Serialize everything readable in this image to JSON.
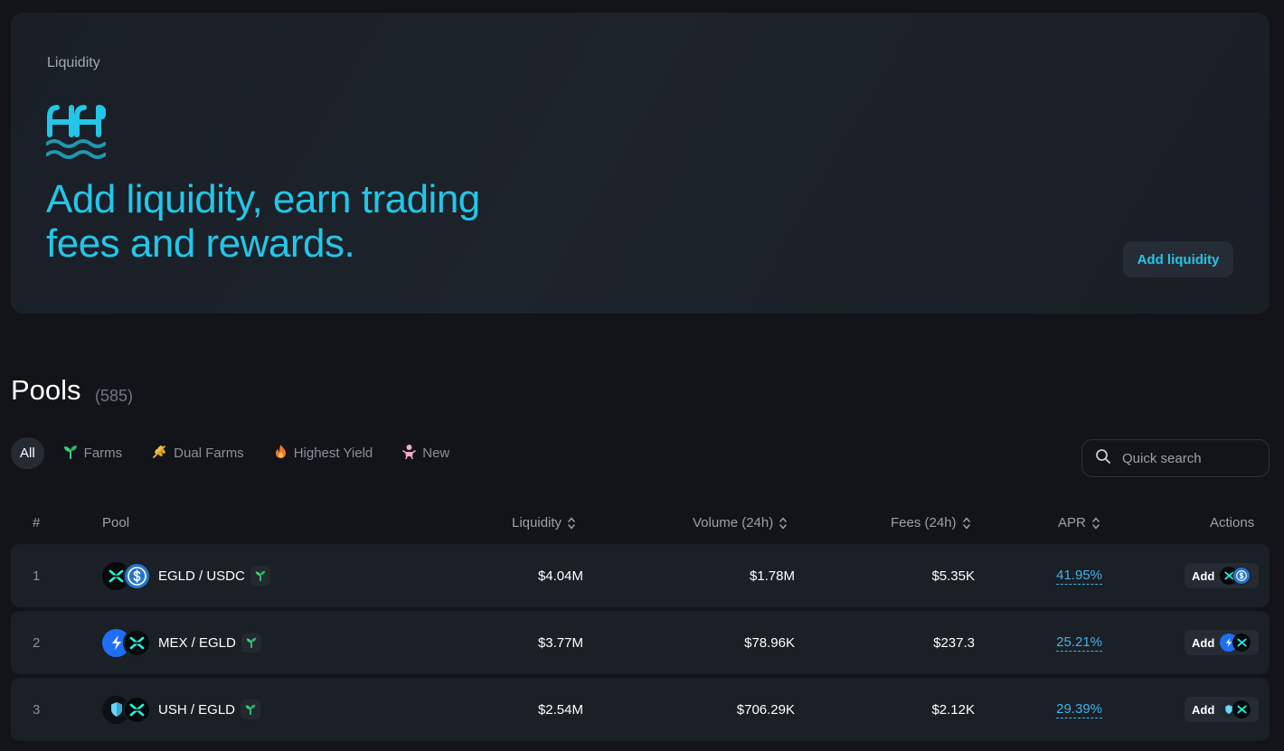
{
  "hero": {
    "subtitle": "Liquidity",
    "title_line1": "Add liquidity, earn trading",
    "title_line2": "fees and rewards.",
    "button_label": "Add liquidity",
    "accent_color": "#23c6e8"
  },
  "pools": {
    "title": "Pools",
    "count": "(585)"
  },
  "filters": [
    {
      "label": "All",
      "icon": "none",
      "active": true
    },
    {
      "label": "Farms",
      "icon": "sprout-icon",
      "active": false
    },
    {
      "label": "Dual Farms",
      "icon": "wheat-icon",
      "active": false
    },
    {
      "label": "Highest Yield",
      "icon": "fire-icon",
      "active": false
    },
    {
      "label": "New",
      "icon": "baby-icon",
      "active": false
    }
  ],
  "search": {
    "placeholder": "Quick search"
  },
  "table": {
    "headers": {
      "rank": "#",
      "pool": "Pool",
      "liquidity": "Liquidity",
      "volume": "Volume (24h)",
      "fees": "Fees (24h)",
      "apr": "APR",
      "actions": "Actions"
    },
    "rows": [
      {
        "rank": "1",
        "pair": "EGLD / USDC",
        "liquidity": "$4.04M",
        "volume": "$1.78M",
        "fees": "$5.35K",
        "apr": "41.95%",
        "action": "Add",
        "tokens": [
          "egld",
          "usdc"
        ]
      },
      {
        "rank": "2",
        "pair": "MEX / EGLD",
        "liquidity": "$3.77M",
        "volume": "$78.96K",
        "fees": "$237.3",
        "apr": "25.21%",
        "action": "Add",
        "tokens": [
          "mex",
          "egld"
        ]
      },
      {
        "rank": "3",
        "pair": "USH / EGLD",
        "liquidity": "$2.54M",
        "volume": "$706.29K",
        "fees": "$2.12K",
        "apr": "29.39%",
        "action": "Add",
        "tokens": [
          "ush",
          "egld"
        ]
      }
    ]
  }
}
